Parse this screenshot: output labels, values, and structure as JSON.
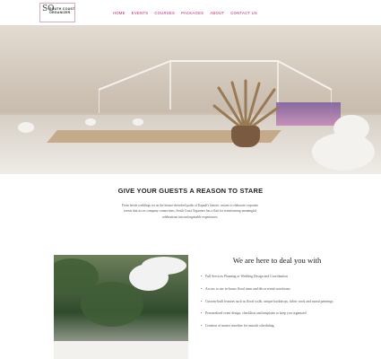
{
  "header": {
    "logo_mark": "SO",
    "logo_text": "SOUTH COAST ORGANIZER",
    "nav": [
      "HOME",
      "EVENTS",
      "COURSES",
      "PACKAGES",
      "ABOUT",
      "CONTACT US"
    ]
  },
  "intro": {
    "title": "GIVE YOUR GUESTS A REASON TO STARE",
    "body": "From lavish weddings set on the leisure-drenched paths of Kapadi's historic venues to elaborate corporate events that act as company connections, South Coast Organizer has a flair for transforming meaningful celebrations into unforgettable experiences."
  },
  "deal": {
    "title": "We are here to deal you with",
    "items": [
      "Full Services Planning or Wedding Design and Coordination",
      "Access to our in-house floral team and décor rental warehouse",
      "Custom-built features such as floral walls, unique backdrops, fabric work and mural paintings",
      "Personalised event design, checklists and templates to keep you organized",
      "Creation of master timeline for smooth scheduling"
    ]
  }
}
